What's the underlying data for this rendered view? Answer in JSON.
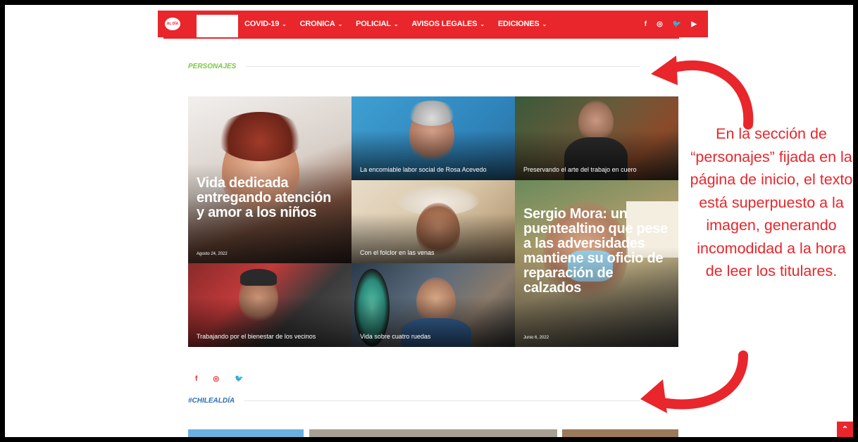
{
  "nav": {
    "logo_text": "AL DÍA",
    "items": [
      {
        "label": "COVID-19"
      },
      {
        "label": "CRONICA"
      },
      {
        "label": "POLICIAL"
      },
      {
        "label": "AVISOS LEGALES"
      },
      {
        "label": "EDICIONES"
      }
    ],
    "social": [
      "f",
      "◎",
      "🐦",
      "▶"
    ]
  },
  "sections": {
    "personajes": "PERSONAJES",
    "chilealdia": "#CHILEALDÍA"
  },
  "tiles": {
    "vida": {
      "title": "Vida dedicada entregando atención y amor a los niños",
      "date": "Agosto 24, 2022"
    },
    "rosa": {
      "caption": "La encomiable labor social de Rosa Acevedo"
    },
    "cuero": {
      "caption": "Preservando el arte del trabajo en cuero"
    },
    "folclor": {
      "caption": "Con el folclor en las venas"
    },
    "sergio": {
      "title": "Sergio Mora: un puentealtino que pese a las adversidades mantiene su oficio de reparación de calzados",
      "date": "Junio 6, 2022"
    },
    "vecinos": {
      "caption": "Trabajando por el bienestar de los vecinos"
    },
    "ruedas": {
      "caption": "Vida sobre cuatro ruedas"
    }
  },
  "footer_social": [
    "f",
    "◎",
    "🐦"
  ],
  "annotation": "En la sección de “personajes” fijada en la página de inicio, el texto está superpuesto a la imagen, generando incomodidad a la hora de leer los titulares.",
  "back_to_top": "^",
  "colors": {
    "accent": "#e8262b",
    "personajes": "#7ac943",
    "chile": "#2d6fb7"
  }
}
